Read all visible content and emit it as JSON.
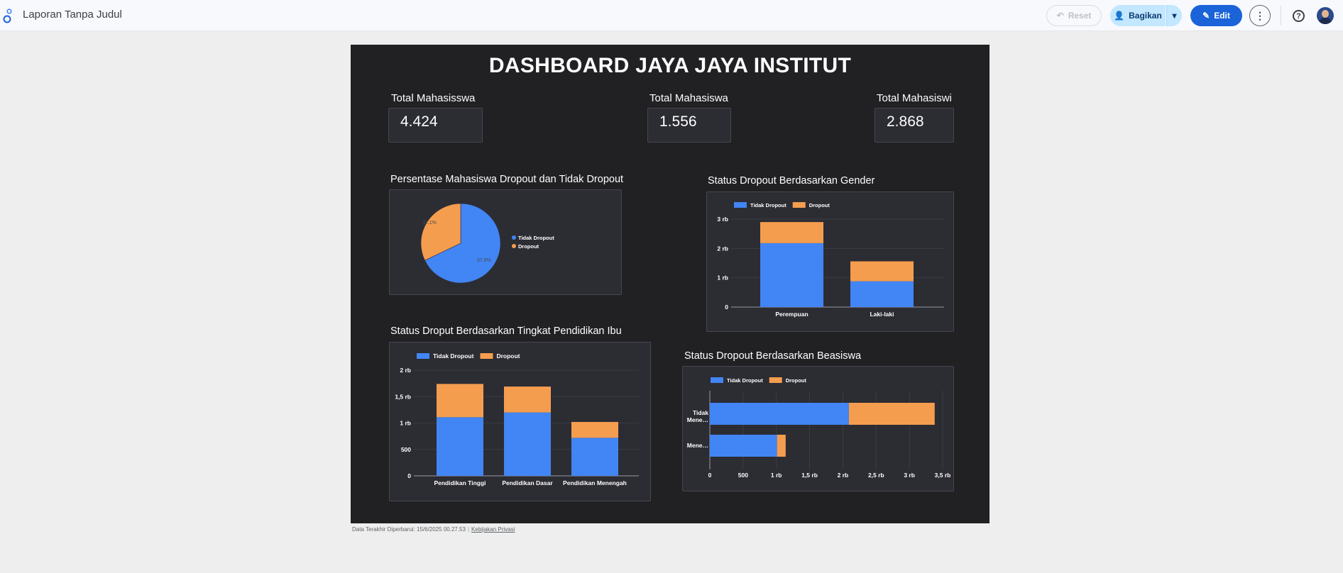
{
  "app": {
    "title": "Laporan Tanpa Judul",
    "toolbar": {
      "reset_label": "Reset",
      "share_label": "Bagikan",
      "edit_label": "Edit",
      "more_icon": "more-vert-icon",
      "help_icon": "help-icon"
    }
  },
  "dashboard": {
    "title": "DASHBOARD JAYA JAYA INSTITUT",
    "kpis": [
      {
        "label": "Total Mahasisswa",
        "value": "4.424"
      },
      {
        "label": "Total Mahasiswa",
        "value": "1.556"
      },
      {
        "label": "Total Mahasiswi",
        "value": "2.868"
      }
    ]
  },
  "colors": {
    "tidak_dropout": "#4285f4",
    "dropout": "#f59d4f",
    "canvas": "#212124",
    "panel": "#2c2c33",
    "accent": "#1a63d8"
  },
  "chart_data": [
    {
      "id": "pie",
      "type": "pie",
      "title": "Persentase Mahasiswa Dropout dan Tidak Dropout",
      "labels": [
        "Tidak Dropout",
        "Dropout"
      ],
      "values": [
        67.9,
        32.1
      ],
      "data_labels": [
        "67.9%",
        "32.1%"
      ],
      "legend": "right"
    },
    {
      "id": "gender",
      "type": "bar",
      "stacked": true,
      "orientation": "vertical",
      "title": "Status Dropout Berdasarkan Gender",
      "categories": [
        "Perempuan",
        "Laki-laki"
      ],
      "series": [
        {
          "name": "Tidak Dropout",
          "values": [
            2180,
            880
          ]
        },
        {
          "name": "Dropout",
          "values": [
            720,
            680
          ]
        }
      ],
      "yticks": [
        "0",
        "1 rb",
        "2 rb",
        "3 rb"
      ],
      "ylim": [
        0,
        3000
      ],
      "legend": "top-left",
      "grid": true
    },
    {
      "id": "ibu",
      "type": "bar",
      "stacked": true,
      "orientation": "vertical",
      "title": "Status Droput Berdasarkan Tingkat Pendidikan Ibu",
      "categories": [
        "Pendidikan Tinggi",
        "Pendidikan Dasar",
        "Pendidikan Menengah"
      ],
      "series": [
        {
          "name": "Tidak Dropout",
          "values": [
            1110,
            1200,
            720
          ]
        },
        {
          "name": "Dropout",
          "values": [
            630,
            490,
            300
          ]
        }
      ],
      "yticks": [
        "0",
        "500",
        "1 rb",
        "1,5 rb",
        "2 rb"
      ],
      "ylim": [
        0,
        2000
      ],
      "legend": "top-left",
      "grid": true
    },
    {
      "id": "beasiswa",
      "type": "bar",
      "stacked": true,
      "orientation": "horizontal",
      "title": "Status Dropout Berdasarkan Beasiswa",
      "categories": [
        "Tidak Mene…",
        "Mene…"
      ],
      "series": [
        {
          "name": "Tidak Dropout",
          "values": [
            2090,
            1010
          ]
        },
        {
          "name": "Dropout",
          "values": [
            1290,
            130
          ]
        }
      ],
      "xticks": [
        "0",
        "500",
        "1 rb",
        "1,5 rb",
        "2 rb",
        "2,5 rb",
        "3 rb",
        "3,5 rb"
      ],
      "xlim": [
        0,
        3500
      ],
      "legend": "top-left",
      "grid": true
    }
  ],
  "footer": {
    "updated": "Data Terakhir Diperbarui: 15/6/2025 00.27.53",
    "privacy": "Kebijakan Privasi"
  }
}
